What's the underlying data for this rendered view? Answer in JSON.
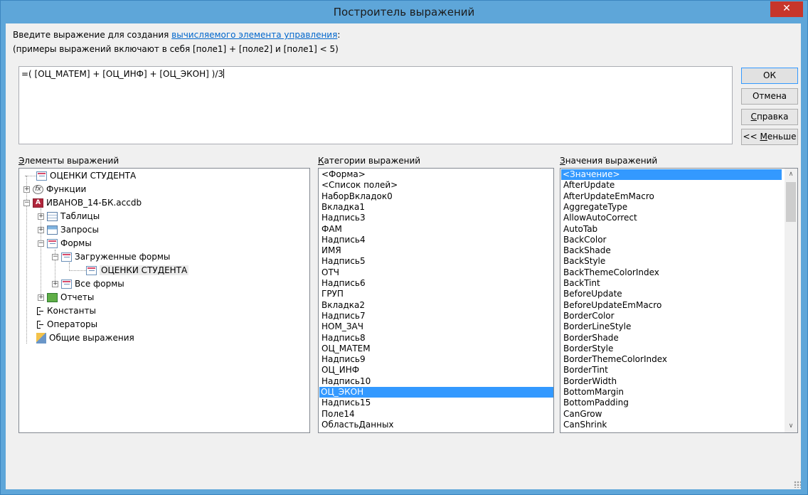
{
  "window": {
    "title": "Построитель выражений",
    "close_glyph": "✕"
  },
  "prompt": {
    "line1_prefix": "Введите выражение для создания ",
    "line1_link": "вычисляемого элемента управления",
    "line1_suffix": ":",
    "line2": "(примеры выражений включают в себя [поле1] + [поле2] и [поле1] < 5)"
  },
  "expression": {
    "value": "=( [ОЦ_МАТЕМ] + [ОЦ_ИНФ] + [ОЦ_ЭКОН] )/3"
  },
  "buttons": {
    "ok": "ОК",
    "cancel": "Отмена",
    "help_u": "С",
    "help_rest": "правка",
    "less_prefix": "<< ",
    "less_u": "М",
    "less_rest": "еньше"
  },
  "sections": {
    "elements_u": "Э",
    "elements_rest": "лементы выражений",
    "categories_u": "К",
    "categories_rest": "атегории выражений",
    "values_u": "З",
    "values_rest": "начения выражений"
  },
  "tree": [
    {
      "label": "ОЦЕНКИ СТУДЕНТА",
      "icon": "form-icon"
    },
    {
      "label": "Функции",
      "icon": "function-icon"
    },
    {
      "label": "ИВАНОВ_14-БК.accdb",
      "icon": "access-db-icon"
    },
    {
      "label": "Таблицы",
      "icon": "table-icon"
    },
    {
      "label": "Запросы",
      "icon": "query-icon"
    },
    {
      "label": "Формы",
      "icon": "form-icon"
    },
    {
      "label": "Загруженные формы",
      "icon": "form-icon"
    },
    {
      "label": "ОЦЕНКИ СТУДЕНТА",
      "icon": "form-icon"
    },
    {
      "label": "Все формы",
      "icon": "form-icon"
    },
    {
      "label": "Отчеты",
      "icon": "report-icon"
    },
    {
      "label": "Константы",
      "icon": "constants-icon"
    },
    {
      "label": "Операторы",
      "icon": "operators-icon"
    },
    {
      "label": "Общие выражения",
      "icon": "common-expressions-icon"
    }
  ],
  "categories": [
    "<Форма>",
    "<Список полей>",
    "НаборВкладок0",
    "Вкладка1",
    "Надпись3",
    "ФАМ",
    "Надпись4",
    "ИМЯ",
    "Надпись5",
    "ОТЧ",
    "Надпись6",
    "ГРУП",
    "Вкладка2",
    "Надпись7",
    "НОМ_ЗАЧ",
    "Надпись8",
    "ОЦ_МАТЕМ",
    "Надпись9",
    "ОЦ_ИНФ",
    "Надпись10",
    "ОЦ_ЭКОН",
    "Надпись15",
    "Поле14",
    "ОбластьДанных"
  ],
  "categories_selected": "ОЦ_ЭКОН",
  "values": [
    "<Значение>",
    "AfterUpdate",
    "AfterUpdateEmMacro",
    "AggregateType",
    "AllowAutoCorrect",
    "AutoTab",
    "BackColor",
    "BackShade",
    "BackStyle",
    "BackThemeColorIndex",
    "BackTint",
    "BeforeUpdate",
    "BeforeUpdateEmMacro",
    "BorderColor",
    "BorderLineStyle",
    "BorderShade",
    "BorderStyle",
    "BorderThemeColorIndex",
    "BorderTint",
    "BorderWidth",
    "BottomMargin",
    "BottomPadding",
    "CanGrow",
    "CanShrink"
  ],
  "values_selected": "<Значение>",
  "icons": {
    "expand_plus": "+",
    "expand_minus": "−",
    "scroll_up": "∧",
    "scroll_down": "∨",
    "fx": "fx",
    "access": "A"
  }
}
